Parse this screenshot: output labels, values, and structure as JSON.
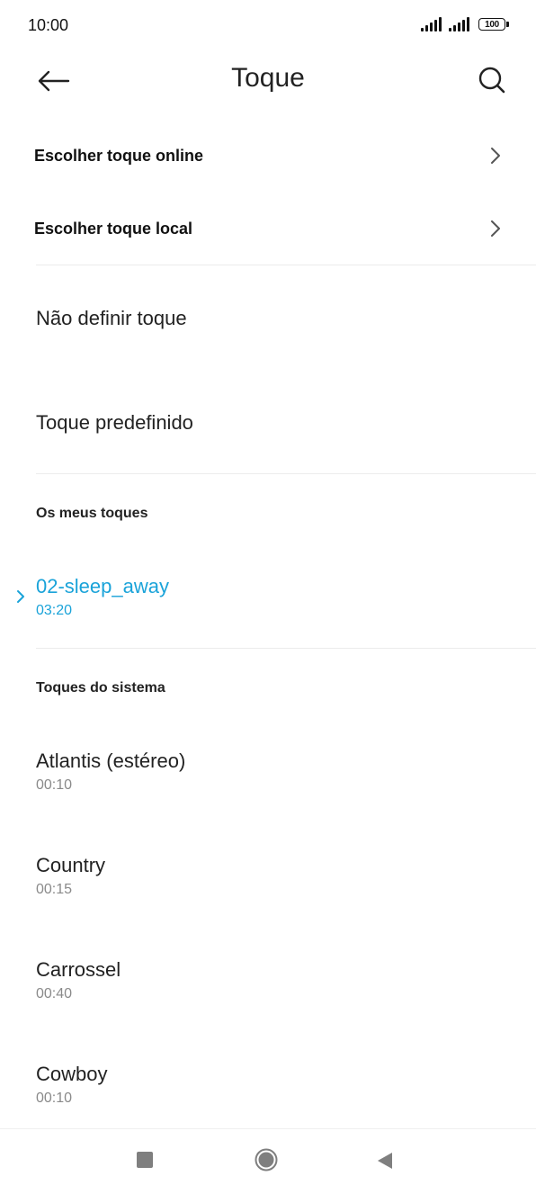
{
  "status_bar": {
    "time": "10:00",
    "battery": "100"
  },
  "header": {
    "title": "Toque",
    "back_icon": "arrow-left-icon",
    "search_icon": "search-icon"
  },
  "online_row": {
    "label": "Escolher toque online",
    "icon": "chevron-right-icon"
  },
  "local_row": {
    "label": "Escolher toque local",
    "icon": "chevron-right-icon"
  },
  "no_ringtone": {
    "label": "Não definir toque"
  },
  "default_ringtone": {
    "label": "Toque predefinido"
  },
  "my_tones": {
    "header": "Os meus toques",
    "items": [
      {
        "name": "02-sleep_away",
        "duration": "03:20",
        "selected": true
      }
    ]
  },
  "system_tones": {
    "header": "Toques do sistema",
    "items": [
      {
        "name": "Atlantis (estéreo)",
        "duration": "00:10"
      },
      {
        "name": "Country",
        "duration": "00:15"
      },
      {
        "name": "Carrossel",
        "duration": "00:40"
      },
      {
        "name": "Cowboy",
        "duration": "00:10"
      }
    ]
  },
  "colors": {
    "accent": "#1aa3d9",
    "text": "#222222",
    "secondary": "#8a8a8a",
    "divider": "#ececec"
  }
}
